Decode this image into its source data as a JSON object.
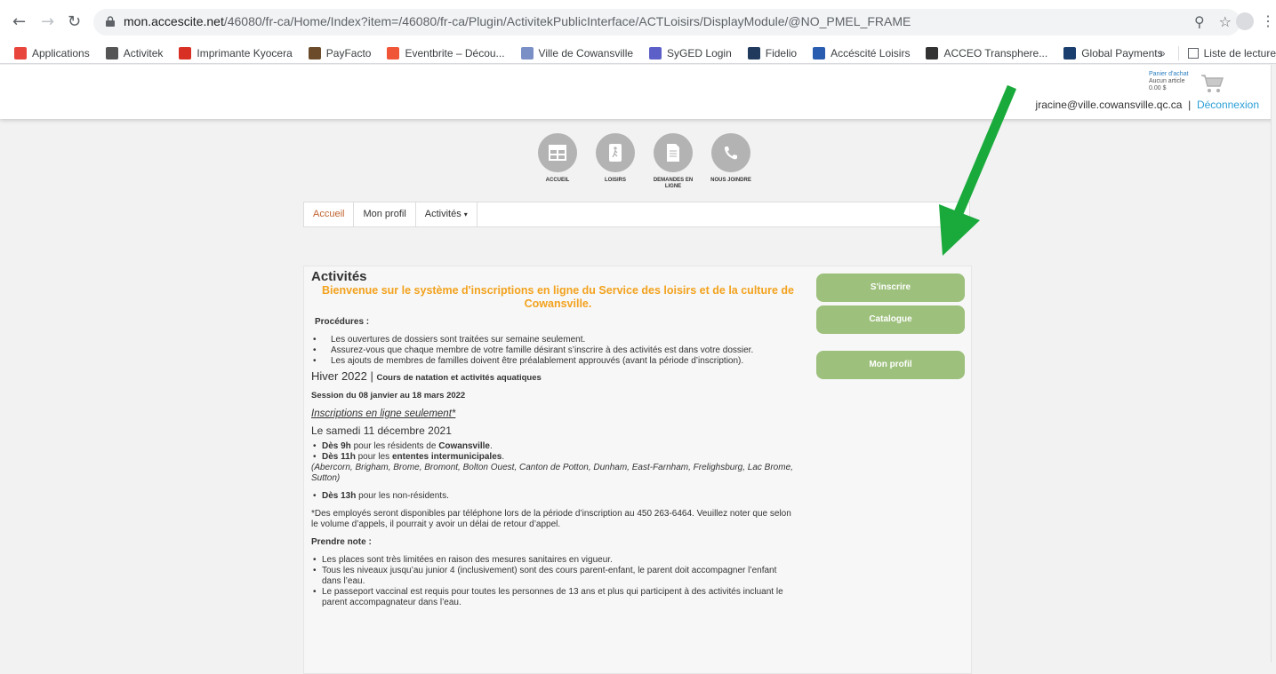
{
  "browser": {
    "url_domain": "mon.accescite.net",
    "url_path": "/46080/fr-ca/Home/Index?item=/46080/fr-ca/Plugin/ActivitekPublicInterface/ACTLoisirs/DisplayModule/@NO_PMEL_FRAME",
    "bookmarks": [
      {
        "label": "Applications",
        "icon": "apps-grid-icon",
        "color": "#e8453c"
      },
      {
        "label": "Activitek",
        "icon": "globe-icon",
        "color": "#555555"
      },
      {
        "label": "Imprimante Kyocera",
        "icon": "kyocera-icon",
        "color": "#d93025"
      },
      {
        "label": "PayFacto",
        "icon": "payfacto-icon",
        "color": "#6b4b2a"
      },
      {
        "label": "Eventbrite – Décou...",
        "icon": "eventbrite-icon",
        "color": "#f05537"
      },
      {
        "label": "Ville de Cowansville",
        "icon": "cowansville-icon",
        "color": "#7b8fc7"
      },
      {
        "label": "SyGED Login",
        "icon": "syged-icon",
        "color": "#5b5fc7"
      },
      {
        "label": "Fidelio",
        "icon": "fidelio-icon",
        "color": "#1f3a5c"
      },
      {
        "label": "Accéscité Loisirs",
        "icon": "accescite-icon",
        "color": "#2a5db0"
      },
      {
        "label": "ACCEO Transphere...",
        "icon": "acceo-icon",
        "color": "#333333"
      },
      {
        "label": "Global Payments",
        "icon": "global-payments-icon",
        "color": "#1a3e6e"
      }
    ],
    "overflow_label": "»",
    "reading_list_label": "Liste de lecture"
  },
  "header": {
    "cart_title": "Panier d'achat",
    "cart_items": "Aucun article",
    "cart_total": "0.00 $",
    "user_email": "jracine@ville.cowansville.qc.ca",
    "separator": "|",
    "logout": "Déconnexion"
  },
  "nav_icons": [
    {
      "label": "ACCUEIL",
      "icon": "home-icon"
    },
    {
      "label": "LOISIRS",
      "icon": "leisure-icon"
    },
    {
      "label": "DEMANDES EN LIGNE",
      "icon": "document-icon"
    },
    {
      "label": "NOUS JOINDRE",
      "icon": "phone-icon"
    }
  ],
  "tabs": {
    "home": "Accueil",
    "profile": "Mon profil",
    "activities": "Activités",
    "caret": "▾"
  },
  "content": {
    "title": "Activités",
    "welcome": "Bienvenue sur le système d'inscriptions en ligne du Service des loisirs et de la culture de Cowansville.",
    "procedures_title": "Procédures :",
    "procedures": [
      "Les ouvertures de dossiers sont traitées sur semaine seulement.",
      "Assurez-vous que chaque membre de votre famille désirant s’inscrire à des activités est dans votre dossier.",
      "Les ajouts de membres de familles doivent être préalablement approuvés (avant la période d’inscription)."
    ],
    "season": "Hiver 2022",
    "season_sep": " | ",
    "season_sub": "Cours de natation et activités aquatiques",
    "session": "Session du 08 janvier au 18 mars 2022",
    "online_only": "Inscriptions en ligne seulement*",
    "date": "Le samedi 11 décembre 2021",
    "r1_time": "Dès 9h",
    "r1_text": " pour les résidents de ",
    "r1_place": "Cowansville",
    "r1_end": ".",
    "r2_time": "Dès 11h",
    "r2_text": " pour les ",
    "r2_place": "ententes intermunicipales",
    "r2_end": ".",
    "towns": "(Abercorn, Brigham, Brome, Bromont, Bolton Ouest, Canton de Potton, Dunham, East-Farnham, Frelighsburg, Lac Brome, Sutton)",
    "r3_time": "Dès 13h",
    "r3_text": " pour les non-résidents.",
    "phone_note": "*Des employés seront disponibles par téléphone lors de la période d’inscription au 450 263-6464. Veuillez noter que selon le volume d’appels, il pourrait y avoir un délai de retour d’appel.",
    "note_title": "Prendre note :",
    "notes": [
      "Les places sont très limitées en raison des mesures sanitaires en vigueur.",
      "Tous les niveaux jusqu’au junior 4 (inclusivement) sont des cours parent-enfant, le parent doit accompagner l’enfant dans l’eau.",
      "Le passeport vaccinal est requis pour toutes les personnes de 13 ans et plus qui participent à des activités incluant le parent accompagnateur dans l’eau."
    ]
  },
  "buttons": {
    "register": "S'inscrire",
    "catalogue": "Catalogue",
    "profile": "Mon profil"
  },
  "colors": {
    "button_green": "#9dc07c",
    "welcome_orange": "#f3a21d",
    "arrow_green": "#1aaa3c",
    "tab_active": "#c0632f"
  }
}
